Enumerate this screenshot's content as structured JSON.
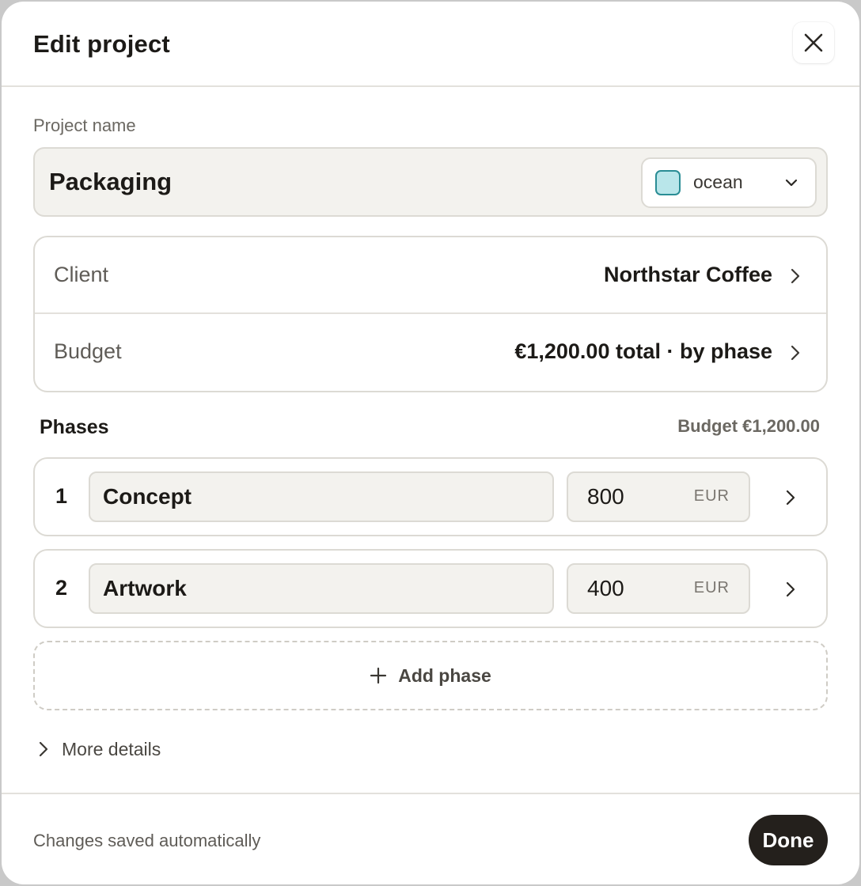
{
  "header": {
    "title": "Edit project",
    "close_icon": "close-icon"
  },
  "project": {
    "name_label": "Project name",
    "name_value": "Packaging",
    "color": {
      "label": "ocean",
      "swatch_fill": "#b9e6ea",
      "swatch_border": "#2a8d95"
    }
  },
  "details": {
    "client_key": "Client",
    "client_value": "Northstar Coffee",
    "budget_key": "Budget",
    "budget_value": "€1,200.00 total · by phase"
  },
  "phases": {
    "title": "Phases",
    "budget_summary": "Budget €1,200.00",
    "items": [
      {
        "number": "1",
        "name": "Concept",
        "amount": "800",
        "currency": "EUR"
      },
      {
        "number": "2",
        "name": "Artwork",
        "amount": "400",
        "currency": "EUR"
      }
    ],
    "add_label": "Add phase"
  },
  "more": {
    "label": "More details"
  },
  "footer": {
    "status": "Changes saved automatically",
    "done_label": "Done"
  },
  "colors": {
    "accent_dark": "#24201c",
    "field_bg": "#f3f2ee",
    "border": "#dcdad4"
  }
}
